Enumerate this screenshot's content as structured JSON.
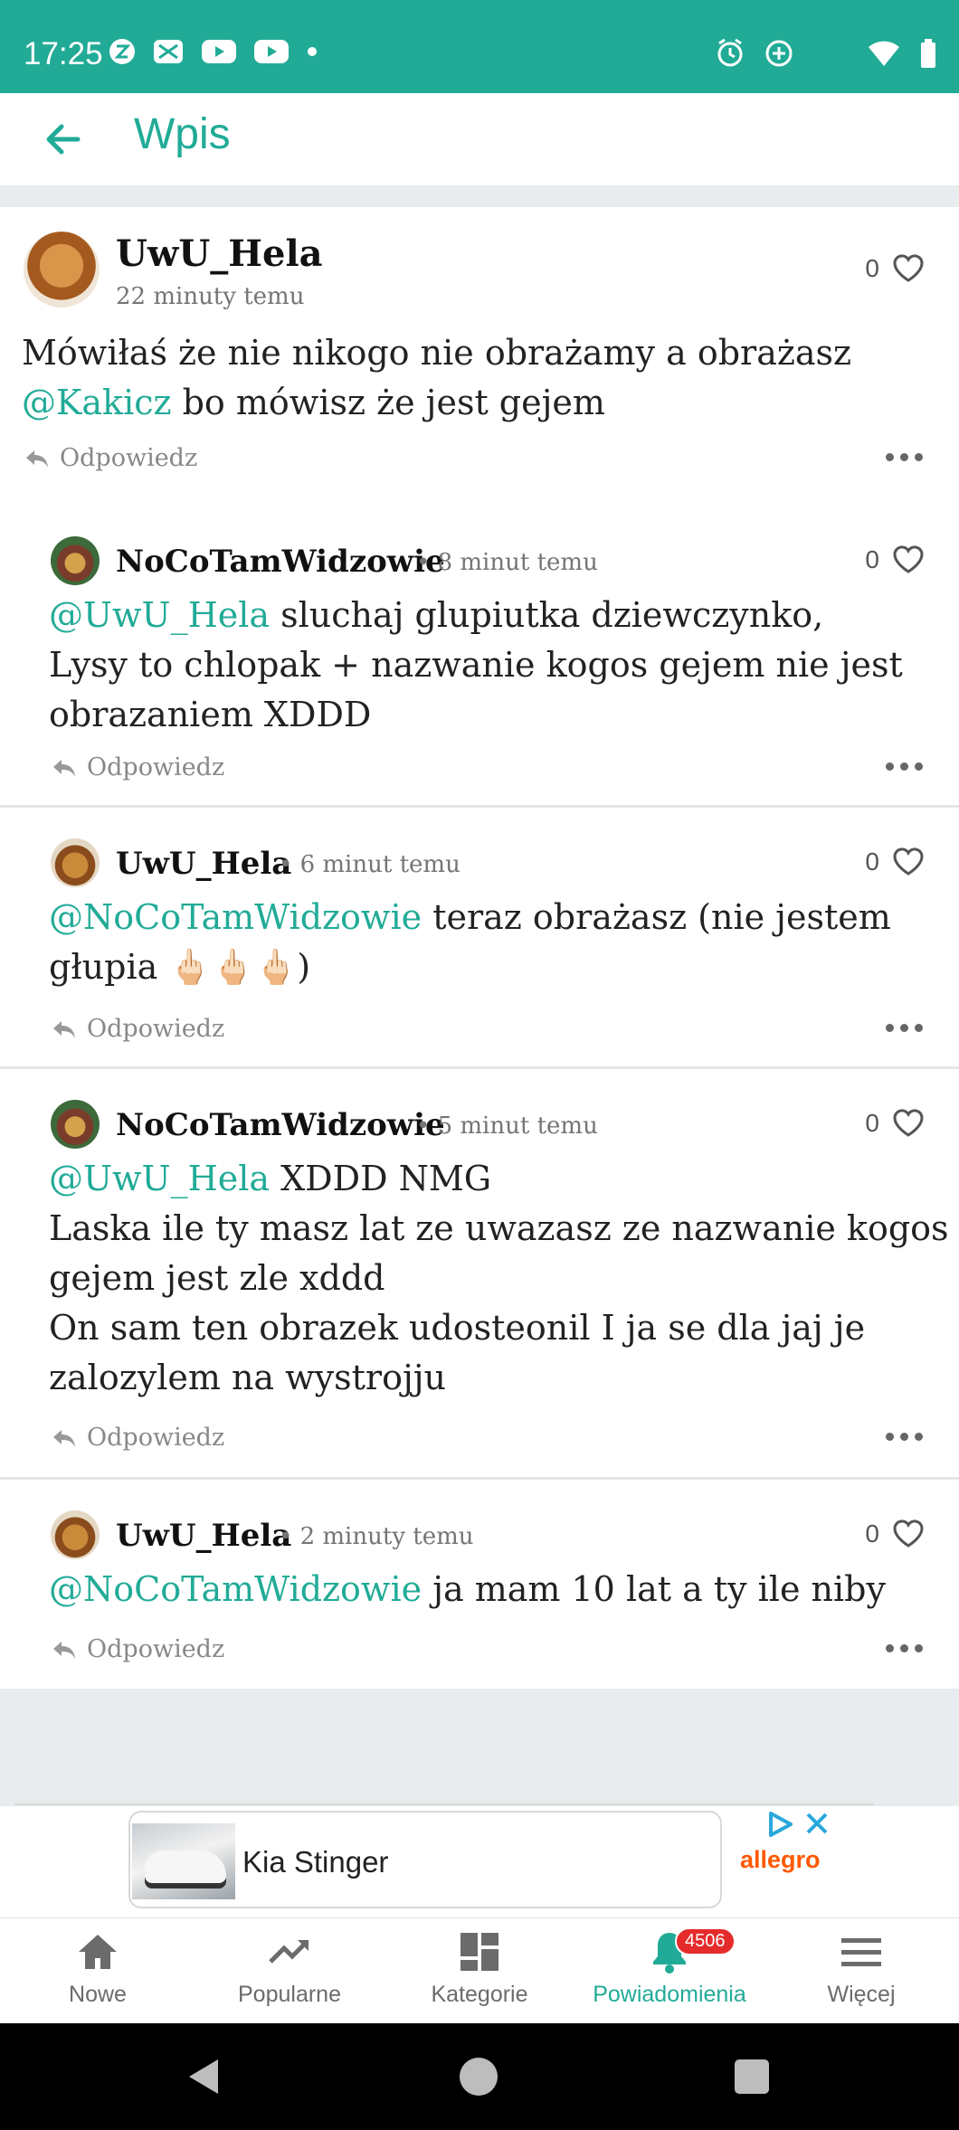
{
  "status_bar": {
    "time": "17:25"
  },
  "app_bar": {
    "title": "Wpis"
  },
  "main_post": {
    "author": "UwU_Hela",
    "time": "22 minuty temu",
    "likes": "0",
    "text_line1": "Mówiłaś że nie nikogo nie obrażamy a obrażasz",
    "mention": "@Kakicz",
    "text_line2_rest": " bo mówisz że jest gejem",
    "reply_label": "Odpowiedz"
  },
  "replies": [
    {
      "author": "NoCoTamWidzowie",
      "time": "• 8 minut temu",
      "likes": "0",
      "mention": "@UwU_Hela",
      "text_rest_line1": " sluchaj glupiutka dziewczynko,",
      "text_line2": "Lysy to chlopak + nazwanie kogos gejem nie jest",
      "text_line3": "obrazaniem XDDD",
      "reply_label": "Odpowiedz"
    },
    {
      "author": "UwU_Hela",
      "time": "• 6 minut temu",
      "likes": "0",
      "mention": "@NoCoTamWidzowie",
      "text_rest_line1": " teraz obrażasz (nie jestem",
      "text_line2": "głupia 🖕🏻🖕🏻🖕🏻)",
      "reply_label": "Odpowiedz"
    },
    {
      "author": "NoCoTamWidzowie",
      "time": "• 5 minut temu",
      "likes": "0",
      "mention": "@UwU_Hela",
      "text_rest_line1": " XDDD NMG",
      "text_line2": "Laska ile ty masz lat ze uwazasz ze nazwanie kogos",
      "text_line3": "gejem jest zle xddd",
      "text_line4": "On sam ten obrazek udosteonil I ja se dla jaj je",
      "text_line5": "zalozylem na wystrojju",
      "reply_label": "Odpowiedz"
    },
    {
      "author": "UwU_Hela",
      "time": "• 2 minuty temu",
      "likes": "0",
      "mention": "@NoCoTamWidzowie",
      "text_rest_line1": " ja mam 10 lat a ty ile niby",
      "reply_label": "Odpowiedz"
    }
  ],
  "ad": {
    "title": "Kia Stinger",
    "brand": "allegro"
  },
  "bottom_nav": {
    "items": [
      {
        "label": "Nowe"
      },
      {
        "label": "Popularne"
      },
      {
        "label": "Kategorie"
      },
      {
        "label": "Powiadomienia"
      },
      {
        "label": "Więcej"
      }
    ],
    "badge": "4506"
  },
  "colors": {
    "accent": "#21ab97",
    "badge": "#e52b2b",
    "brand_allegro": "#ff5a00"
  }
}
